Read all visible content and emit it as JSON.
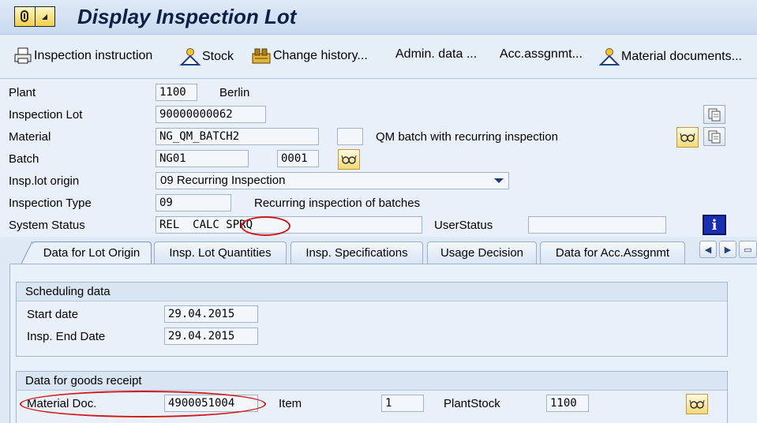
{
  "title": "Display Inspection Lot",
  "toolbar": {
    "inspection_instruction": "Inspection instruction",
    "stock": "Stock",
    "change_history": "Change history...",
    "admin_data": "Admin. data ...",
    "acc_assgnmt": "Acc.assgnmt...",
    "material_documents": "Material documents..."
  },
  "header": {
    "plant_label": "Plant",
    "plant_value": "1100",
    "plant_name": "Berlin",
    "inspection_lot_label": "Inspection Lot",
    "inspection_lot_value": "90000000062",
    "material_label": "Material",
    "material_value": "NG_QM_BATCH2",
    "material_desc": "QM batch with recurring inspection",
    "batch_label": "Batch",
    "batch_value": "NG01",
    "batch_sub_value": "0001",
    "lot_origin_label": "Insp.lot origin",
    "lot_origin_value": "09 Recurring Inspection",
    "insp_type_label": "Inspection Type",
    "insp_type_value": "09",
    "insp_type_desc": "Recurring inspection of batches",
    "system_status_label": "System Status",
    "system_status_value": "REL  CALC SPRQ",
    "user_status_label": "UserStatus",
    "user_status_value": ""
  },
  "tabs": [
    {
      "label": "Data for Lot Origin"
    },
    {
      "label": "Insp. Lot Quantities"
    },
    {
      "label": "Insp. Specifications"
    },
    {
      "label": "Usage Decision"
    },
    {
      "label": "Data for Acc.Assgnmt"
    }
  ],
  "scheduling": {
    "title": "Scheduling data",
    "start_date_label": "Start date",
    "start_date_value": "29.04.2015",
    "end_date_label": "Insp. End Date",
    "end_date_value": "29.04.2015"
  },
  "goods_receipt": {
    "title": "Data for goods receipt",
    "material_doc_label": "Material Doc.",
    "material_doc_value": "4900051004",
    "item_label": "Item",
    "item_value": "1",
    "plant_stock_label": "PlantStock",
    "plant_stock_value": "1100"
  },
  "colors": {
    "highlight": "#d01a1a",
    "title_text": "#0c1f46",
    "info_button": "#1a2fb0"
  }
}
